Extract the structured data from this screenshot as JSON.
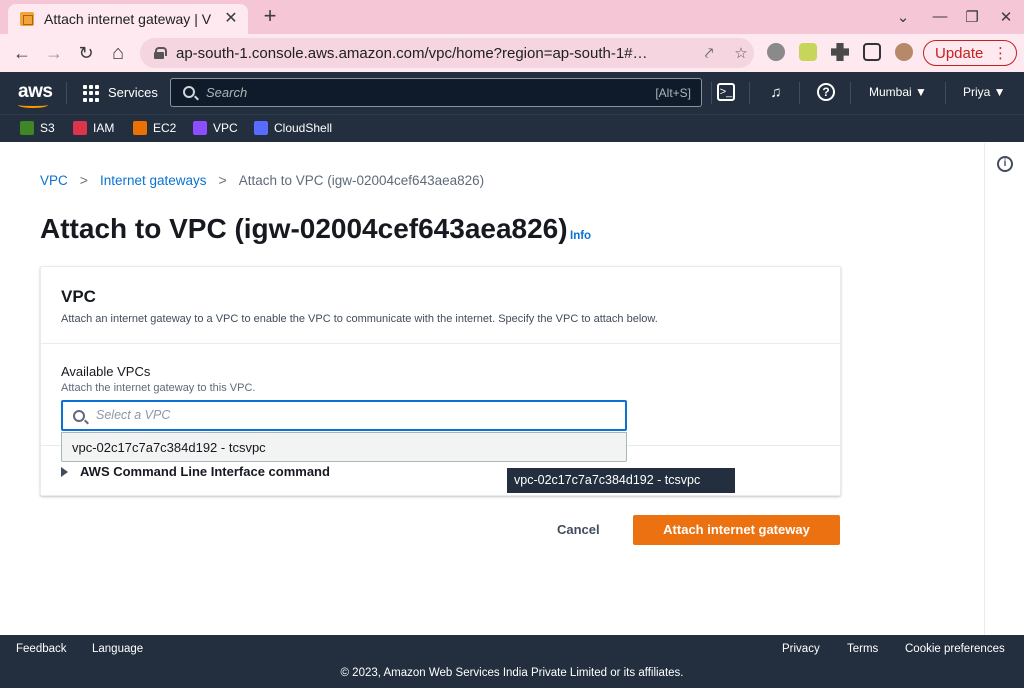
{
  "browser": {
    "tab_title": "Attach internet gateway | V",
    "url": "ap-south-1.console.aws.amazon.com/vpc/home?region=ap-south-1#…",
    "update_label": "Update",
    "controls": {
      "back": "←",
      "forward": "→",
      "reload": "↻",
      "home": "⌂",
      "close_tab": "✕",
      "new_tab": "+",
      "share": "⤤",
      "star": "☆",
      "kebab": "⋮",
      "chevron": "⌄",
      "minimize": "—",
      "restore": "❐",
      "close_window": "✕"
    },
    "icons": [
      "lock-icon",
      "share-icon",
      "star-icon",
      "extensions-icon",
      "profile-avatar"
    ]
  },
  "aws_header": {
    "logo": "aws",
    "services_label": "Services",
    "search_placeholder": "Search",
    "search_shortcut": "[Alt+S]",
    "cloudshell_glyph": "⊡",
    "bell_glyph": "🔔",
    "help_glyph": "?",
    "region_label": "Mumbai ▼",
    "user_label": "Priya ▼"
  },
  "favorites": [
    {
      "label": "S3",
      "color": "#3f8624"
    },
    {
      "label": "IAM",
      "color": "#dd344c"
    },
    {
      "label": "EC2",
      "color": "#ed7100"
    },
    {
      "label": "VPC",
      "color": "#8c4fff"
    },
    {
      "label": "CloudShell",
      "color": "#5a6bff"
    }
  ],
  "breadcrumb": {
    "items": [
      "VPC",
      "Internet gateways"
    ],
    "current": "Attach to VPC (igw-02004cef643aea826)",
    "separator": ">"
  },
  "page": {
    "title": "Attach to VPC (igw-02004cef643aea826)",
    "info_label": "Info",
    "info_glyph": "i"
  },
  "panel": {
    "title": "VPC",
    "description": "Attach an internet gateway to a VPC to enable the VPC to communicate with the internet. Specify the VPC to attach below.",
    "field_label": "Available VPCs",
    "field_description": "Attach the internet gateway to this VPC.",
    "select_placeholder": "Select a VPC",
    "dropdown_options": [
      "vpc-02c17c7a7c384d192 - tcsvpc"
    ],
    "cli_toggle_label": "AWS Command Line Interface command"
  },
  "tooltip": "vpc-02c17c7a7c384d192 - tcsvpc",
  "actions": {
    "cancel_label": "Cancel",
    "primary_label": "Attach internet gateway"
  },
  "footer": {
    "feedback": "Feedback",
    "language": "Language",
    "privacy": "Privacy",
    "terms": "Terms",
    "cookies": "Cookie preferences",
    "copyright": "© 2023, Amazon Web Services India Private Limited or its affiliates."
  },
  "colors": {
    "aws_nav": "#232f3e",
    "link": "#0972d3",
    "primary_button": "#ec7211",
    "browser_frame": "#f4c6d6"
  }
}
